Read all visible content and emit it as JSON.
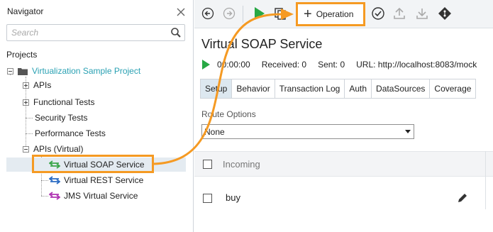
{
  "navigator": {
    "title": "Navigator",
    "search_placeholder": "Search",
    "projects_label": "Projects",
    "project_name": "Virtualization Sample Project",
    "items": {
      "apis": "APIs",
      "functional_tests": "Functional Tests",
      "security_tests": "Security Tests",
      "performance_tests": "Performance Tests",
      "apis_virtual": "APIs (Virtual)",
      "virtual_soap": "Virtual SOAP Service",
      "virtual_rest": "Virtual REST Service",
      "jms_virtual": "JMS Virtual Service"
    }
  },
  "toolbar": {
    "operation_label": "Operation"
  },
  "service": {
    "title": "Virtual SOAP Service",
    "elapsed": "00:00:00",
    "received": "Received: 0",
    "sent": "Sent: 0",
    "url": "URL: http://localhost:8083/mock"
  },
  "tabs": [
    "Setup",
    "Behavior",
    "Transaction Log",
    "Auth",
    "DataSources",
    "Coverage"
  ],
  "route": {
    "label": "Route Options",
    "value": "None"
  },
  "grid": {
    "header": "Incoming",
    "row_name": "buy"
  },
  "colors": {
    "accent_orange": "#f59a23",
    "project_teal": "#2aa1b3",
    "run_green": "#27a844",
    "soap_green": "#3aa64a",
    "rest_blue": "#2b6cc4",
    "jms_purple": "#b035b3"
  }
}
